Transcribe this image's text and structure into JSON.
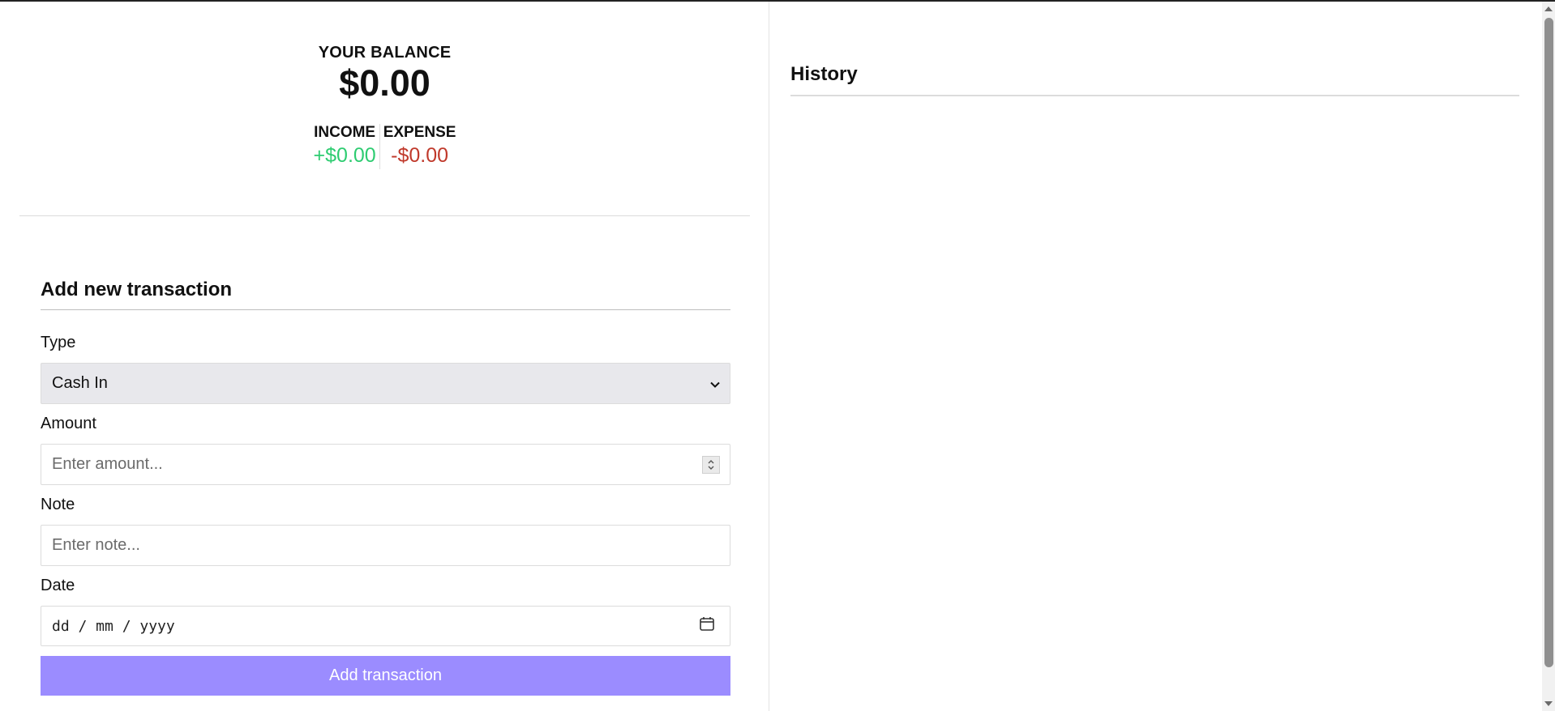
{
  "balance": {
    "label": "YOUR BALANCE",
    "amount": "$0.00"
  },
  "summary": {
    "income_label": "INCOME",
    "income_value": "+$0.00",
    "expense_label": "EXPENSE",
    "expense_value": "-$0.00",
    "income_color": "#2ecc71",
    "expense_color": "#c0392b"
  },
  "form": {
    "title": "Add new transaction",
    "type_label": "Type",
    "type_value": "Cash In",
    "amount_label": "Amount",
    "amount_placeholder": "Enter amount...",
    "note_label": "Note",
    "note_placeholder": "Enter note...",
    "date_label": "Date",
    "date_placeholder": "dd / mm / yyyy",
    "submit_label": "Add transaction",
    "submit_color": "#9b8cff"
  },
  "history": {
    "title": "History"
  },
  "icons": {
    "select": "chevron-down-icon",
    "amount": "spinner-icon",
    "date": "calendar-icon"
  }
}
